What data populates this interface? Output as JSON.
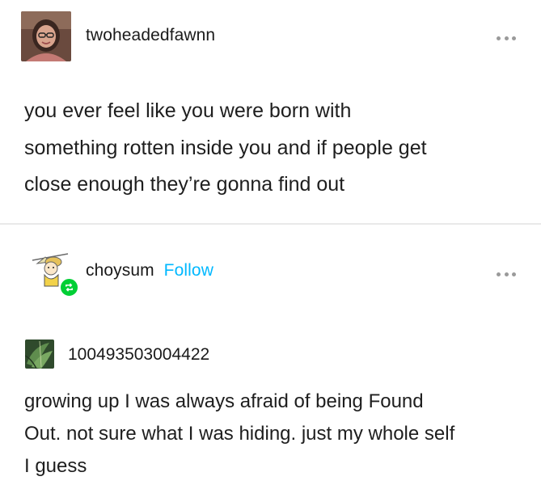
{
  "post1": {
    "username": "twoheadedfawnn",
    "more_icon": "ellipsis-icon",
    "text_lines": [
      "you ever feel like you were born with",
      "something rotten inside you and if people get",
      "close enough they’re gonna find out"
    ]
  },
  "post2": {
    "username": "choysum",
    "follow_label": "Follow",
    "reblog_icon": "reblog-icon",
    "more_icon": "ellipsis-icon",
    "comment": {
      "username": "100493503004422",
      "text_lines": [
        "growing up I was always afraid of being Found",
        "Out. not sure what I was hiding. just my whole self",
        "I guess"
      ]
    }
  },
  "colors": {
    "follow": "#00b8ff",
    "reblog_badge": "#00cf35",
    "divider": "#e9e9e9"
  }
}
